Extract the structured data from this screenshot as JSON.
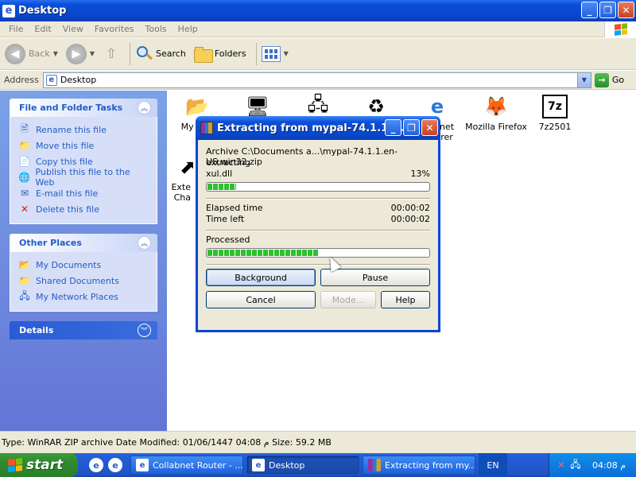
{
  "window": {
    "title": "Desktop"
  },
  "menu": [
    "File",
    "Edit",
    "View",
    "Favorites",
    "Tools",
    "Help"
  ],
  "toolbar": {
    "back_label": "Back",
    "search_label": "Search",
    "folders_label": "Folders"
  },
  "address": {
    "label": "Address",
    "value": "Desktop",
    "go_label": "Go"
  },
  "left_pane": {
    "file_tasks": {
      "title": "File and Folder Tasks",
      "items": [
        "Rename this file",
        "Move this file",
        "Copy this file",
        "Publish this file to the Web",
        "E-mail this file",
        "Delete this file"
      ]
    },
    "other_places": {
      "title": "Other Places",
      "items": [
        "My Documents",
        "Shared Documents",
        "My Network Places"
      ]
    },
    "details": {
      "title": "Details"
    }
  },
  "desktop_icons": [
    {
      "label": "My Doc",
      "icon": "my-documents-icon"
    },
    {
      "label": "",
      "icon": "my-computer-icon"
    },
    {
      "label": "",
      "icon": "network-icon"
    },
    {
      "label": "",
      "icon": "recycle-bin-icon"
    },
    {
      "label": "net",
      "label2": "rer",
      "icon": "internet-explorer-icon"
    },
    {
      "label": "Mozilla Firefox",
      "icon": "firefox-icon"
    },
    {
      "label": "7z2501",
      "icon": "sevenzip-icon"
    },
    {
      "label": "Exte",
      "label2": "Cha",
      "icon": "shortcut-icon"
    }
  ],
  "dialog": {
    "title": "Extracting from mypal-74.1.1....",
    "archive_line": "Archive C:\\Documents a...\\mypal-74.1.1.en-US.win32.zip",
    "action": "extracting",
    "file_name": "xul.dll",
    "file_percent": "13%",
    "file_progress": 0.13,
    "elapsed_label": "Elapsed time",
    "elapsed_value": "00:00:02",
    "timeleft_label": "Time left",
    "timeleft_value": "00:00:02",
    "processed_label": "Processed",
    "processed_progress": 0.5,
    "buttons": {
      "background": "Background",
      "pause": "Pause",
      "cancel": "Cancel",
      "mode": "Mode...",
      "help": "Help"
    }
  },
  "status": {
    "text": "Type: WinRAR ZIP archive Date Modified: 01/06/1447 04:08 م Size: 59.2 MB"
  },
  "taskbar": {
    "start_label": "start",
    "tasks": [
      {
        "label": "Collabnet Router - ...",
        "active": false
      },
      {
        "label": "Desktop",
        "active": true
      },
      {
        "label": "Extracting from my...",
        "active": false
      }
    ],
    "language": "EN",
    "clock": "04:08 م"
  },
  "colors": {
    "xp_blue": "#0a4fd8",
    "panel_bg": "#6375d6",
    "progress_green": "#2fc02f"
  }
}
